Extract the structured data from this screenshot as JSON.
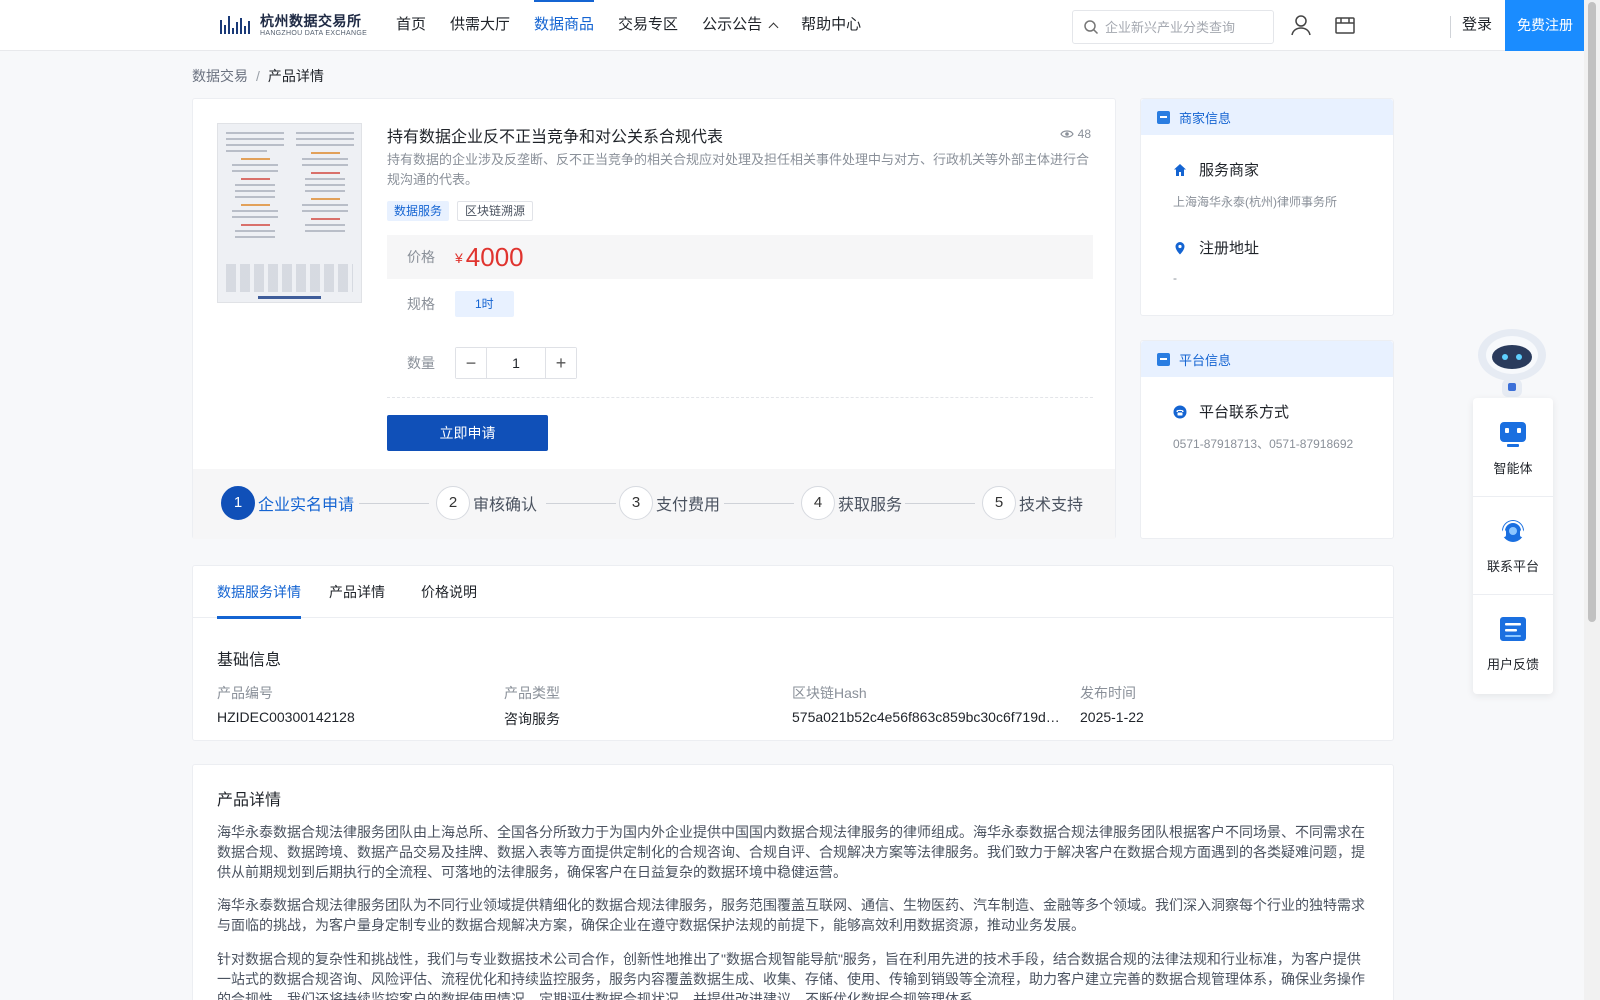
{
  "header": {
    "logo_cn": "杭州数据交易所",
    "logo_en": "HANGZHOU DATA EXCHANGE",
    "nav": [
      {
        "label": "首页",
        "active": false
      },
      {
        "label": "供需大厅",
        "active": false
      },
      {
        "label": "数据商品",
        "active": true
      },
      {
        "label": "交易专区",
        "active": false
      },
      {
        "label": "公示公告",
        "active": false,
        "dropdown": true
      },
      {
        "label": "帮助中心",
        "active": false
      }
    ],
    "search_placeholder": "企业新兴产业分类查询",
    "login_label": "登录",
    "register_label": "免费注册"
  },
  "breadcrumb": {
    "parent": "数据交易",
    "separator": "/",
    "current": "产品详情"
  },
  "product": {
    "title": "持有数据企业反不正当竞争和对公关系合规代表",
    "views": "48",
    "description": "持有数据的企业涉及反垄断、反不正当竞争的相关合规应对处理及担任相关事件处理中与对方、行政机关等外部主体进行合规沟通的代表。",
    "tags": [
      "数据服务",
      "区块链溯源"
    ],
    "price_label": "价格",
    "currency": "¥",
    "price": "4000",
    "spec_label": "规格",
    "spec_value": "1时",
    "qty_label": "数量",
    "qty_value": "1",
    "qty_minus": "−",
    "qty_plus": "+",
    "apply_label": "立即申请"
  },
  "steps": [
    {
      "num": "1",
      "label": "企业实名申请",
      "active": true
    },
    {
      "num": "2",
      "label": "审核确认",
      "active": false
    },
    {
      "num": "3",
      "label": "支付费用",
      "active": false
    },
    {
      "num": "4",
      "label": "获取服务",
      "active": false
    },
    {
      "num": "5",
      "label": "技术支持",
      "active": false
    }
  ],
  "merchant": {
    "header": "商家信息",
    "provider_label": "服务商家",
    "provider_value": "上海海华永泰(杭州)律师事务所",
    "address_label": "注册地址",
    "address_value": "-"
  },
  "platform": {
    "header": "平台信息",
    "contact_label": "平台联系方式",
    "contact_value": "0571-87918713、0571-87918692"
  },
  "float_widget": {
    "items": [
      {
        "label": "智能体",
        "icon": "agent-icon"
      },
      {
        "label": "联系平台",
        "icon": "headset-icon"
      },
      {
        "label": "用户反馈",
        "icon": "feedback-icon"
      }
    ]
  },
  "tabs": [
    {
      "label": "数据服务详情",
      "active": true
    },
    {
      "label": "产品详情",
      "active": false
    },
    {
      "label": "价格说明",
      "active": false
    }
  ],
  "basic_info": {
    "title": "基础信息",
    "fields": [
      {
        "key": "产品编号",
        "value": "HZIDEC00300142128"
      },
      {
        "key": "产品类型",
        "value": "咨询服务"
      },
      {
        "key": "区块链Hash",
        "value": "575a021b52c4e56f863c859bc30c6f719d4..."
      },
      {
        "key": "发布时间",
        "value": "2025-1-22"
      }
    ]
  },
  "detail": {
    "title": "产品详情",
    "paragraphs": [
      "海华永泰数据合规法律服务团队由上海总所、全国各分所致力于为国内外企业提供中国国内数据合规法律服务的律师组成。海华永泰数据合规法律服务团队根据客户不同场景、不同需求在数据合规、数据跨境、数据产品交易及挂牌、数据入表等方面提供定制化的合规咨询、合规自评、合规解决方案等法律服务。我们致力于解决客户在数据合规方面遇到的各类疑难问题，提供从前期规划到后期执行的全流程、可落地的法律服务，确保客户在日益复杂的数据环境中稳健运营。",
      "海华永泰数据合规法律服务团队为不同行业领域提供精细化的数据合规法律服务，服务范围覆盖互联网、通信、生物医药、汽车制造、金融等多个领域。我们深入洞察每个行业的独特需求与面临的挑战，为客户量身定制专业的数据合规解决方案，确保企业在遵守数据保护法规的前提下，能够高效利用数据资源，推动业务发展。",
      "针对数据合规的复杂性和挑战性，我们与专业数据技术公司合作，创新性地推出了\"数据合规智能导航\"服务，旨在利用先进的技术手段，结合数据合规的法律法规和行业标准，为客户提供一站式的数据合规咨询、风险评估、流程优化和持续监控服务，服务内容覆盖数据生成、收集、存储、使用、传输到销毁等全流程，助力客户建立完善的数据合规管理体系，确保业务操作的合规性。我们还将持续监控客户的数据使用情况，定期评估数据合规状况，并提供改进建议，不断优化数据合规管理体系。"
    ]
  },
  "colors": {
    "primary": "#1464d2",
    "button": "#1050b8",
    "register": "#1a8cff",
    "price": "#e0342f"
  }
}
